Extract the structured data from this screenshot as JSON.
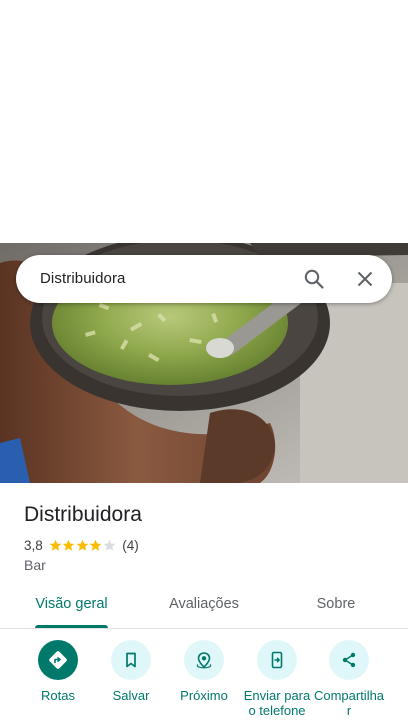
{
  "search": {
    "query": "Distribuidora",
    "search_icon": "search-icon",
    "close_icon": "close-icon"
  },
  "place": {
    "title": "Distribuidora",
    "rating": "3,8",
    "stars": 3.8,
    "review_count": "(4)",
    "category": "Bar",
    "star_color": "#fbbc04"
  },
  "tabs": [
    {
      "label": "Visão geral",
      "active": true
    },
    {
      "label": "Avaliações",
      "active": false
    },
    {
      "label": "Sobre",
      "active": false
    }
  ],
  "actions": [
    {
      "label": "Rotas",
      "icon": "directions-icon"
    },
    {
      "label": "Salvar",
      "icon": "bookmark-icon"
    },
    {
      "label": "Próximo",
      "icon": "nearby-icon"
    },
    {
      "label": "Enviar para o telefone",
      "icon": "send-to-phone-icon"
    },
    {
      "label": "Compartilhar",
      "icon": "share-icon"
    }
  ],
  "colors": {
    "accent": "#00796b",
    "action_bg": "#e0f7f9"
  }
}
